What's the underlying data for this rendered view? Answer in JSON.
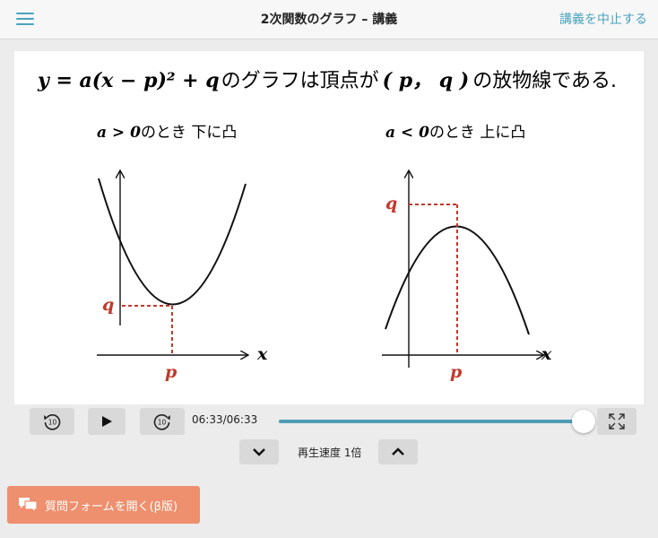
{
  "header": {
    "title": "2次関数のグラフ – 講義",
    "action_label": "講義を中止する"
  },
  "slide": {
    "formula": "y = a(x − p)² + q",
    "headline_text": "のグラフは頂点が",
    "vertex_text": "( p， q )",
    "headline_tail": "の放物線である.",
    "left_caption_math": "a > 0",
    "left_caption_text": "のとき  下に凸",
    "right_caption_math": "a < 0",
    "right_caption_text": "のとき  上に凸",
    "label_q": "q",
    "label_p": "p",
    "label_x": "x"
  },
  "player": {
    "rewind_label": "10",
    "forward_label": "10",
    "time": "06:33/06:33",
    "progress": 1.0,
    "speed_label": "再生速度 1倍"
  },
  "question_button": {
    "label": "質問フォームを開く(β版)"
  },
  "colors": {
    "accent": "#4aa3bf",
    "progress": "#4f9db5",
    "annotation_red": "#c0392b",
    "question_button": "#ee8f6e"
  }
}
